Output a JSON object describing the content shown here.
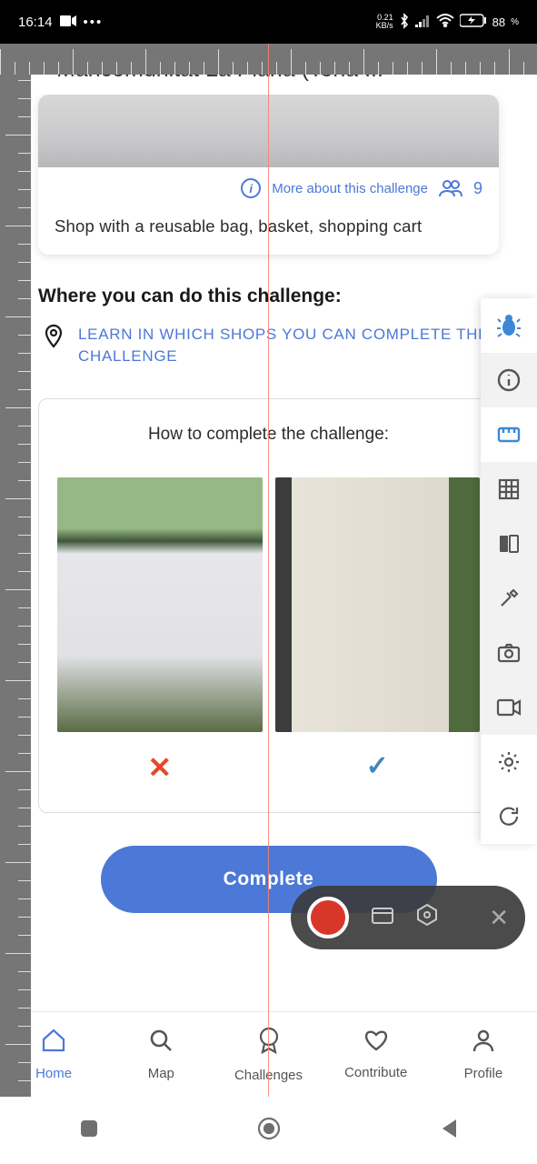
{
  "status": {
    "time": "16:14",
    "net": "0.21",
    "net_unit": "KB/s",
    "battery": "88",
    "battery_pct": "%"
  },
  "appbar": {
    "title": "Mancomunitat La Plana (Tona ..."
  },
  "card": {
    "more": "More about this challenge",
    "count": "9",
    "desc": "Shop with a reusable bag, basket, shopping cart"
  },
  "section": {
    "where": "Where you can do this challenge:",
    "learn": "LEARN IN WHICH SHOPS YOU CAN COMPLETE THE CHALLENGE"
  },
  "how": {
    "title": "How to complete the challenge:"
  },
  "action": {
    "complete": "Complete"
  },
  "nav": {
    "home": "Home",
    "map": "Map",
    "challenges": "Challenges",
    "contribute": "Contribute",
    "profile": "Profile"
  }
}
